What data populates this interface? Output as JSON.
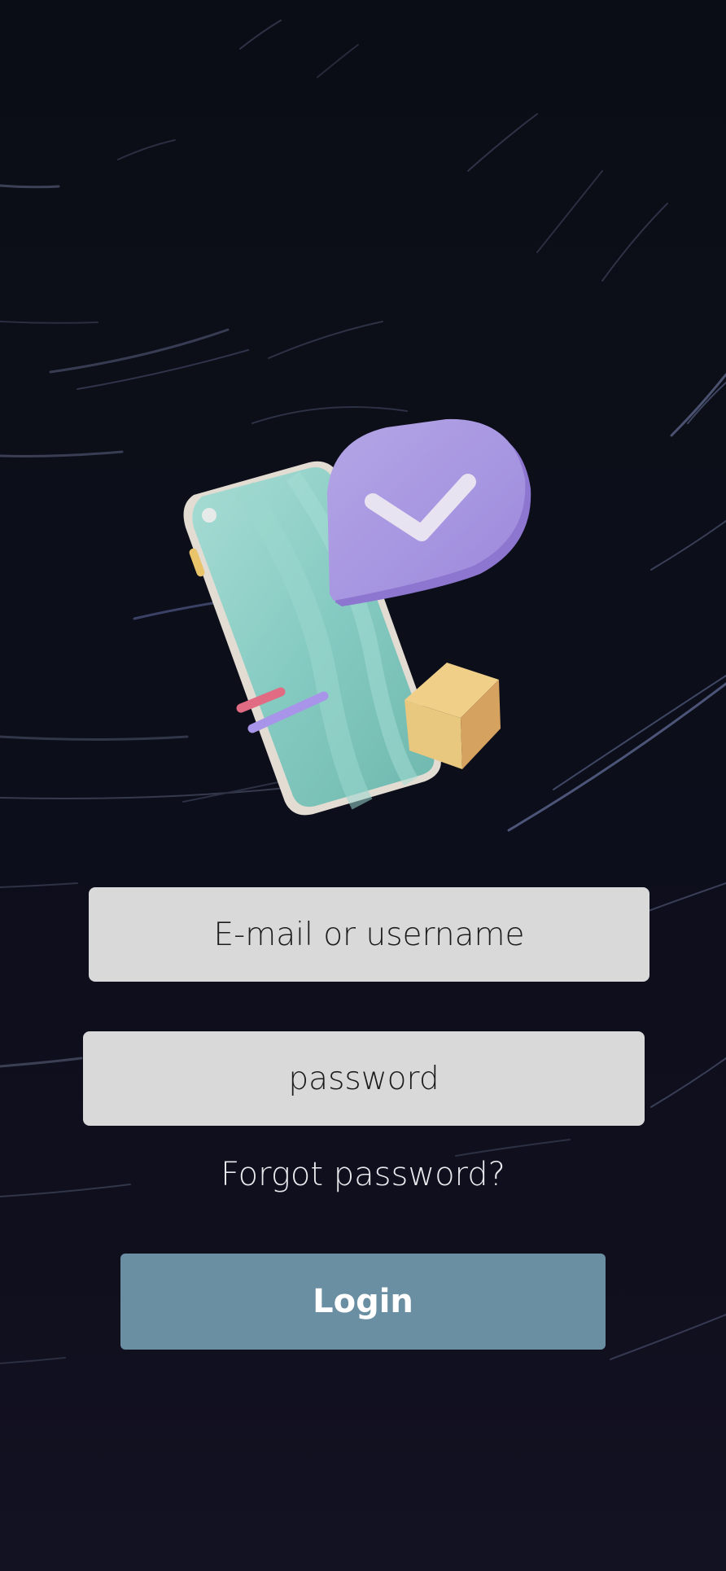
{
  "login_form": {
    "email_placeholder": "E-mail or username",
    "password_placeholder": "password",
    "forgot_password_link": "Forgot password?",
    "login_button": "Login"
  },
  "colors": {
    "background": "#0b0d16",
    "input_background": "#d9d9d9",
    "login_button": "#6a8fa2",
    "illustration_phone": "#8fd1c8",
    "illustration_pin": "#a794e0",
    "illustration_box": "#e3b96f"
  },
  "illustration": {
    "icons": [
      "phone-icon",
      "location-pin-icon",
      "checkmark-icon",
      "box-icon"
    ]
  }
}
